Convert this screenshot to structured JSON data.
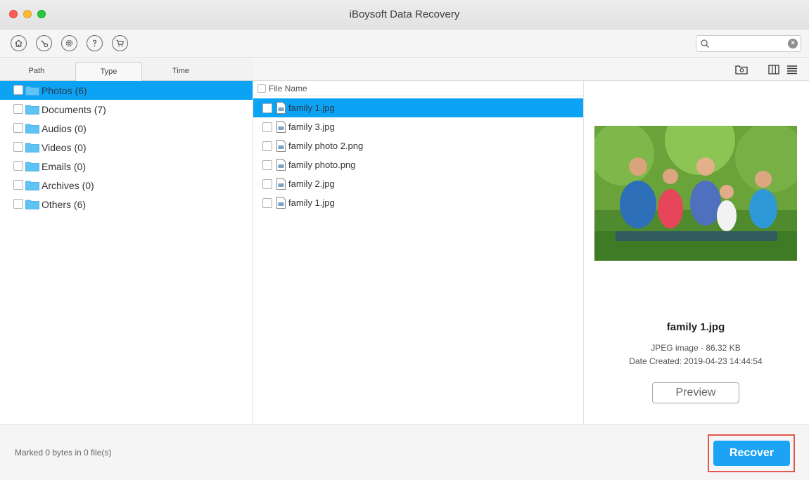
{
  "window": {
    "title": "iBoysoft Data Recovery"
  },
  "toolbar": {
    "buttons": [
      "home-icon",
      "wrench-icon",
      "gear-icon",
      "help-icon",
      "cart-icon"
    ],
    "search": {
      "value": "",
      "placeholder": ""
    }
  },
  "tabs": [
    {
      "label": "Path",
      "active": false
    },
    {
      "label": "Type",
      "active": true
    },
    {
      "label": "Time",
      "active": false
    }
  ],
  "categories": [
    {
      "label": "Photos (6)",
      "selected": true
    },
    {
      "label": "Documents (7)",
      "selected": false
    },
    {
      "label": "Audios (0)",
      "selected": false
    },
    {
      "label": "Videos (0)",
      "selected": false
    },
    {
      "label": "Emails (0)",
      "selected": false
    },
    {
      "label": "Archives (0)",
      "selected": false
    },
    {
      "label": "Others (6)",
      "selected": false
    }
  ],
  "filelist": {
    "column_header": "File Name",
    "files": [
      {
        "name": "family 1.jpg",
        "selected": true
      },
      {
        "name": "family 3.jpg",
        "selected": false
      },
      {
        "name": "family photo 2.png",
        "selected": false
      },
      {
        "name": "family photo.png",
        "selected": false
      },
      {
        "name": "family 2.jpg",
        "selected": false
      },
      {
        "name": "family 1.jpg",
        "selected": false
      }
    ]
  },
  "preview": {
    "name": "family 1.jpg",
    "type_size": "JPEG image - 86.32 KB",
    "date_created": "Date Created: 2019-04-23 14:44:54",
    "button_label": "Preview"
  },
  "footer": {
    "marked": "Marked 0 bytes in 0 file(s)",
    "recover_label": "Recover"
  },
  "colors": {
    "accent": "#1da3f4",
    "selection": "#0ca3f5",
    "highlight": "#e2574c"
  }
}
